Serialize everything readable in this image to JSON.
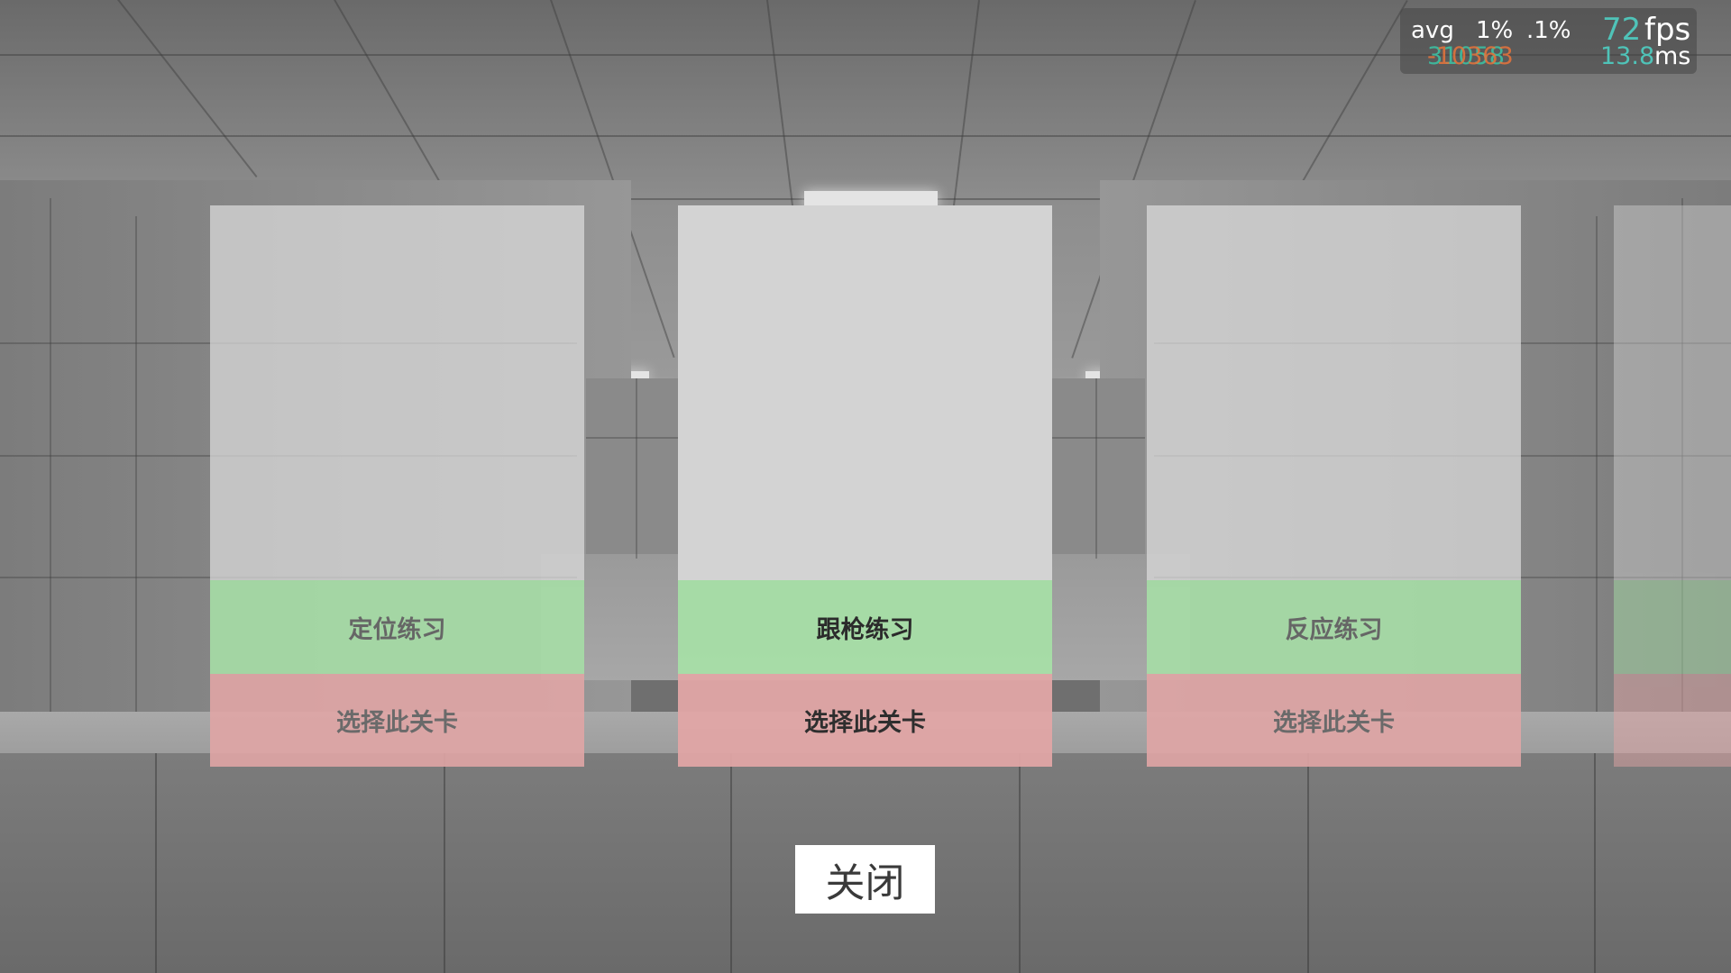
{
  "hud": {
    "stats_header": {
      "avg": "avg",
      "p1": "1%",
      "p01": ".1%"
    },
    "fps_value": "72",
    "fps_unit": "fps",
    "lows_readout": "-10363",
    "lows_readout_overlap": "31058",
    "frametime_value": "13.8",
    "frametime_unit": "ms",
    "colors": {
      "fps_value": "#4fc3b8",
      "lows_a": "#e8743b",
      "lows_b": "#3fb59a",
      "frametime_value": "#4fc3b8"
    }
  },
  "levels": [
    {
      "name": "定位练习",
      "select_label": "选择此关卡"
    },
    {
      "name": "跟枪练习",
      "select_label": "选择此关卡"
    },
    {
      "name": "反应练习",
      "select_label": "选择此关卡"
    },
    {
      "name": "",
      "select_label": ""
    }
  ],
  "close_label": "关闭",
  "colors": {
    "name_bar": "#a6dea6",
    "select_bar": "#e0a5a5",
    "preview": "#d3d3d3",
    "close_button_bg": "#ffffff"
  }
}
